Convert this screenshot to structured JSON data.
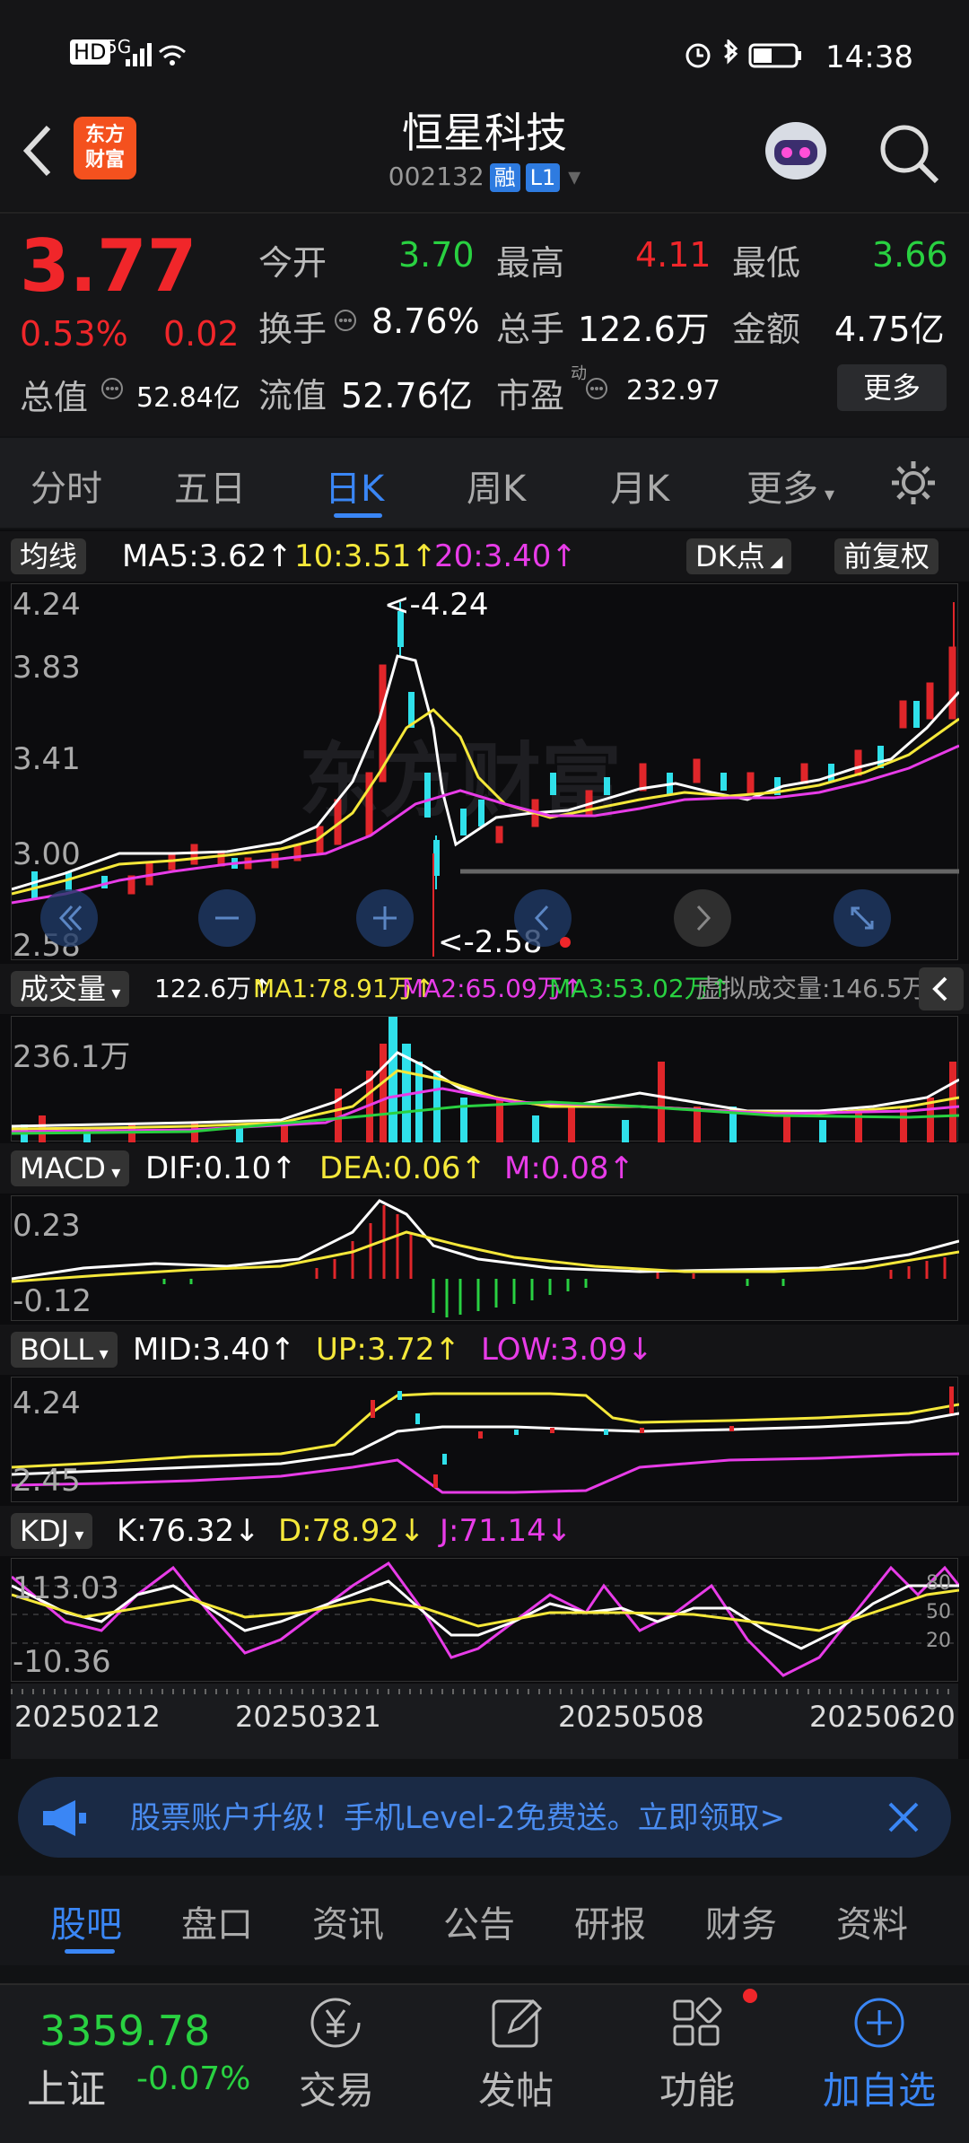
{
  "status": {
    "time": "14:38",
    "hd": "HD",
    "net": "5G"
  },
  "header": {
    "logo_line1": "东方",
    "logo_line2": "财富",
    "name": "恒星科技",
    "code": "002132",
    "tag1": "融",
    "tag2": "L1"
  },
  "quote": {
    "price": "3.77",
    "change_pct": "0.53%",
    "change": "0.02",
    "open_label": "今开",
    "open": "3.70",
    "high_label": "最高",
    "high": "4.11",
    "low_label": "最低",
    "low": "3.66",
    "turnover_label": "换手",
    "turnover": "8.76%",
    "vol_label": "总手",
    "vol": "122.6万",
    "amount_label": "金额",
    "amount": "4.75亿",
    "mktcap_label": "总值",
    "mktcap": "52.84亿",
    "float_label": "流值",
    "float_cap": "52.76亿",
    "pe_label": "市盈",
    "pe_sup": "动",
    "pe": "232.97",
    "more": "更多"
  },
  "tabs": [
    "分时",
    "五日",
    "日K",
    "周K",
    "月K",
    "更多"
  ],
  "ma_row": {
    "btn": "均线",
    "ma5": "MA5:3.62↑",
    "ma10": "10:3.51↑",
    "ma20": "20:3.40↑",
    "dk": "DK点",
    "fq": "前复权"
  },
  "kline": {
    "ymax": "4.24",
    "y2": "3.83",
    "y3": "3.41",
    "y4": "3.00",
    "ymin": "2.58",
    "high_mark": "<-4.24",
    "low_mark": "<-2.58"
  },
  "vol_row": {
    "btn": "成交量",
    "v": "122.6万↑",
    "ma1": "MA1:78.91万↑",
    "ma2": "MA2:65.09万↑",
    "ma3": "MA3:53.02万↑",
    "virtual": "虚拟成交量:146.5万",
    "ymax": "236.1万"
  },
  "macd_row": {
    "btn": "MACD",
    "dif": "DIF:0.10↑",
    "dea": "DEA:0.06↑",
    "m": "M:0.08↑",
    "ymax": "0.23",
    "ymin": "-0.12"
  },
  "boll_row": {
    "btn": "BOLL",
    "mid": "MID:3.40↑",
    "up": "UP:3.72↑",
    "low": "LOW:3.09↓",
    "ymax": "4.24",
    "ymin": "2.45"
  },
  "kdj_row": {
    "btn": "KDJ",
    "k": "K:76.32↓",
    "d": "D:78.92↓",
    "j": "J:71.14↓",
    "ymax": "113.03",
    "ymin": "-10.36",
    "g80": "80",
    "g50": "50",
    "g20": "20"
  },
  "dates": [
    "20250212",
    "20250321",
    "20250508",
    "20250620"
  ],
  "banner": "股票账户升级！手机Level-2免费送。立即领取>",
  "bottom_tabs": [
    "股吧",
    "盘口",
    "资讯",
    "公告",
    "研报",
    "财务",
    "资料"
  ],
  "footer": {
    "index_value": "3359.78",
    "index_name": "上证",
    "index_change": "-0.07%",
    "trade": "交易",
    "post": "发帖",
    "func": "功能",
    "watch": "加自选"
  },
  "colors": {
    "up": "#f0262a",
    "down": "#29d141",
    "accent": "#3a86f5",
    "ma5": "#ffffff",
    "ma10": "#f5e83a",
    "ma20": "#e83ce8"
  }
}
